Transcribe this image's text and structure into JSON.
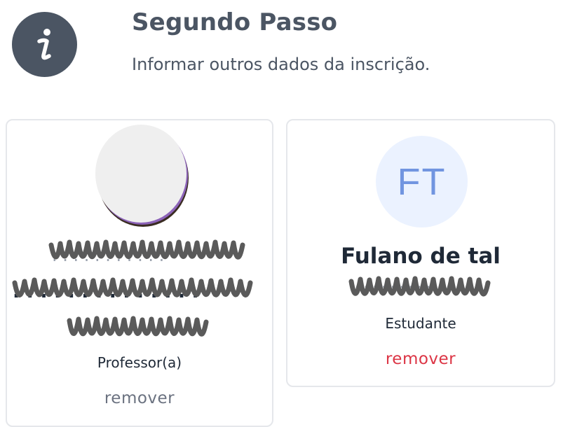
{
  "header": {
    "title": "Segundo Passo",
    "subtitle": "Informar outros dados da inscrição.",
    "icon": "info-icon"
  },
  "participants": [
    {
      "avatar": "photo-avatar",
      "name_redacted": true,
      "role": "Professor(a)",
      "remove_label": "remover",
      "remove_color": "#6b7280"
    },
    {
      "avatar_initials": "FT",
      "name": "Fulano de tal",
      "role": "Estudante",
      "remove_label": "remover",
      "remove_color": "#dc3545"
    }
  ],
  "colors": {
    "icon_background": "#4b5563",
    "initials_background": "#ebf2ff",
    "initials_text": "#7195e0",
    "card_border": "#e5e7eb",
    "redaction": "#5a5a5a"
  }
}
